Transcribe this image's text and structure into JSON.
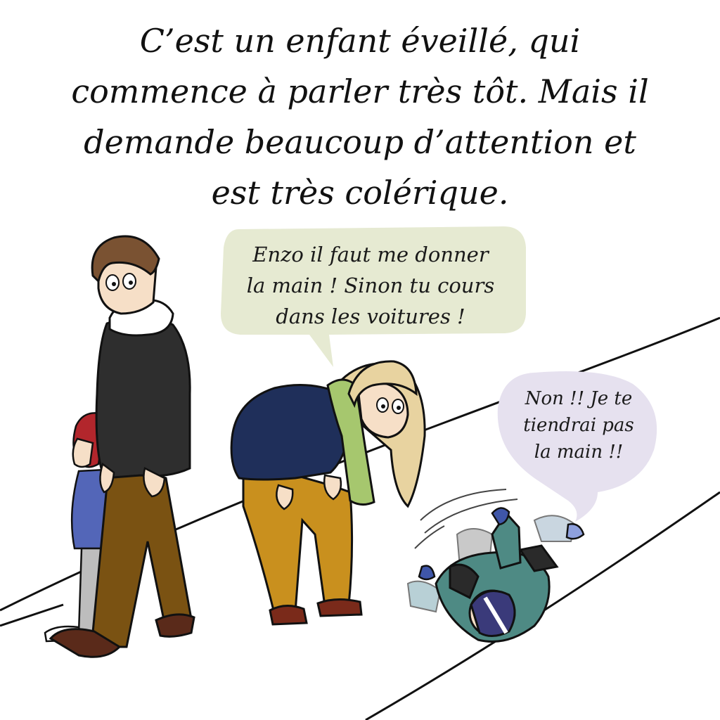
{
  "caption": {
    "lines": [
      "C’est un enfant éveillé, qui",
      "commence à parler très tôt. Mais il",
      "demande beaucoup d’attention et",
      "est très colérique."
    ]
  },
  "bubbles": {
    "mother": {
      "lines": [
        "Enzo il faut me donner",
        "la main ! Sinon tu cours",
        "dans les voitures !"
      ],
      "color": "#e6ead2"
    },
    "child": {
      "lines": [
        "Non !! Je te",
        "tiendrai pas",
        "la main !!"
      ],
      "color": "#e6e1ef"
    }
  },
  "colors": {
    "father_coat": "#2e2e2e",
    "father_pants": "#7a5212",
    "mother_coat": "#1f2f5a",
    "mother_pants": "#c9901e",
    "mother_scarf": "#a6c76e",
    "mother_hair": "#e8d3a0",
    "child_jacket": "#4e8a84",
    "small_child_coat": "#5366b8",
    "small_child_hat": "#b2262c"
  }
}
